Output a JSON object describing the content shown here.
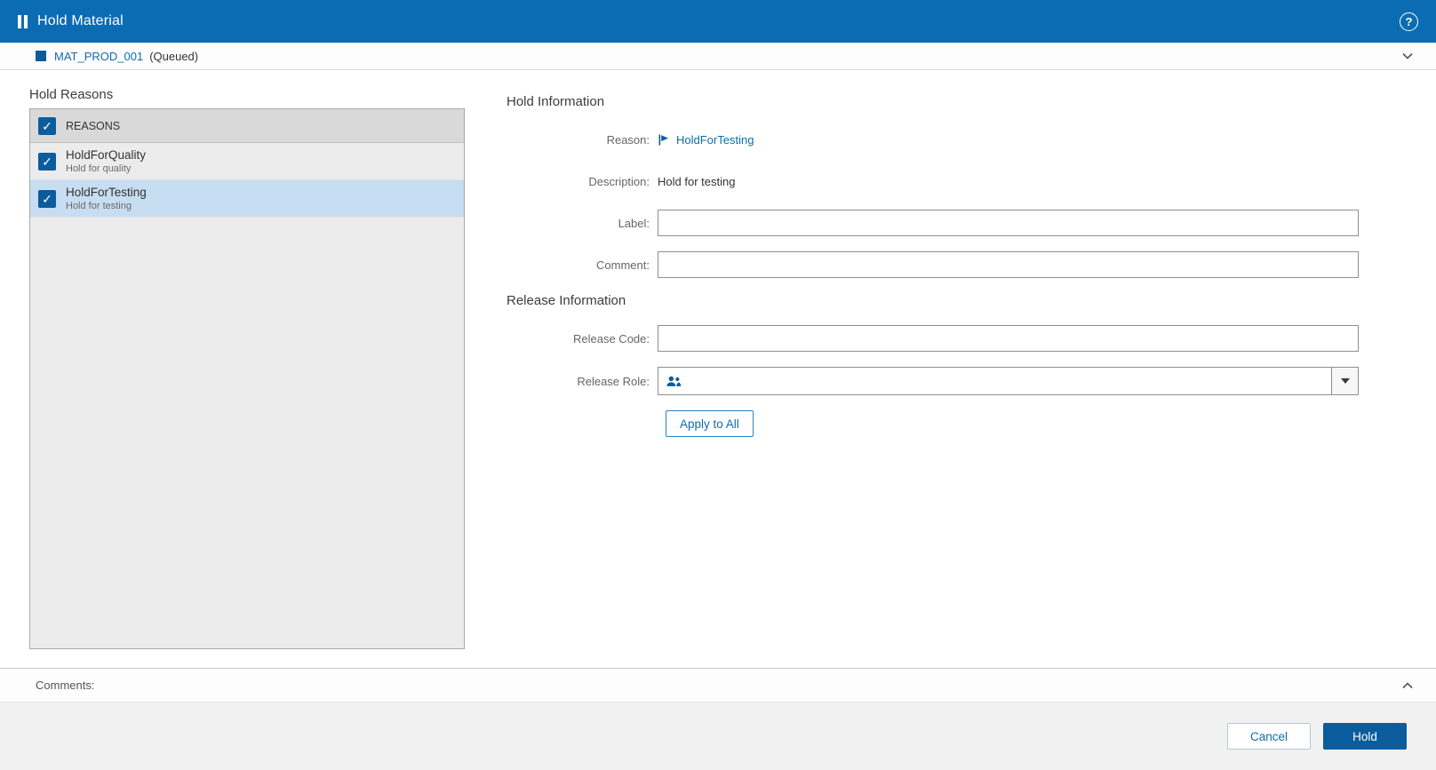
{
  "icons": {
    "help": "?",
    "check": "✓"
  },
  "header": {
    "title": "Hold Material"
  },
  "context_bar": {
    "material_id": "MAT_PROD_001",
    "status": "(Queued)"
  },
  "hold_reasons": {
    "section_label": "Hold Reasons",
    "list_header": "REASONS",
    "items": [
      {
        "name": "HoldForQuality",
        "description": "Hold for quality",
        "checked": true,
        "selected": false
      },
      {
        "name": "HoldForTesting",
        "description": "Hold for testing",
        "checked": true,
        "selected": true
      }
    ]
  },
  "hold_information": {
    "title": "Hold Information",
    "reason_label": "Reason:",
    "reason_value": "HoldForTesting",
    "description_label": "Description:",
    "description_value": "Hold for testing",
    "label_label": "Label:",
    "label_value": "",
    "comment_label": "Comment:",
    "comment_value": ""
  },
  "release_information": {
    "title": "Release Information",
    "release_code_label": "Release Code:",
    "release_code_value": "",
    "release_role_label": "Release Role:",
    "release_role_value": "",
    "apply_to_all_label": "Apply to All"
  },
  "comments": {
    "label": "Comments:"
  },
  "footer": {
    "cancel_label": "Cancel",
    "hold_label": "Hold"
  },
  "colors": {
    "header_bg": "#0c6cb3",
    "primary": "#0f6cad",
    "primary_dark": "#0b5c9d",
    "selected_row": "#c7ddf1"
  }
}
